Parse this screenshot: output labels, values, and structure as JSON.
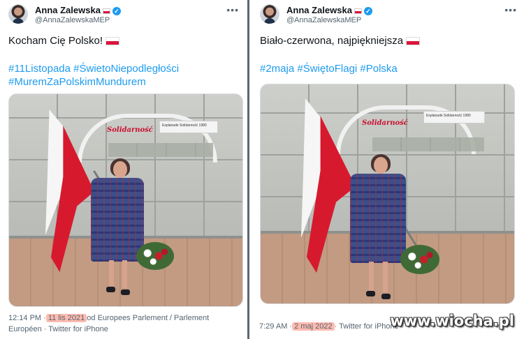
{
  "left_tweet": {
    "author_name": "Anna Zalewska",
    "author_handle": "@AnnaZalewskaMEP",
    "more_label": "•••",
    "text": "Kocham Cię Polsko!",
    "hashtags_line1": "#11Listopada #ŚwietoNiepodległości",
    "hashtags_line2": "#MuremZaPolskimMundurem",
    "time": "12:14 PM · ",
    "date": "11 lis 2021",
    "source": " od Europees Parlement / Parlement Européen · Twitter for iPhone",
    "photo": {
      "sign_text": "Esplanade Solidarność 1980",
      "logo_text": "Solidarność"
    }
  },
  "right_tweet": {
    "author_name": "Anna Zalewska",
    "author_handle": "@AnnaZalewskaMEP",
    "more_label": "•••",
    "text": "Biało-czerwona, najpiękniejsza",
    "hashtags": "#2maja #ŚwiętoFlagi #Polska",
    "time": "7:29 AM · ",
    "date": "2 maj 2022",
    "source": " · Twitter for iPhone",
    "photo": {
      "sign_text": "Esplanade Solidarność 1980",
      "logo_text": "Solidarność"
    }
  },
  "watermark": "www.wiocha.pl",
  "colors": {
    "link": "#1d9bf0",
    "flag_red": "#dc143c",
    "muted": "#536471"
  }
}
